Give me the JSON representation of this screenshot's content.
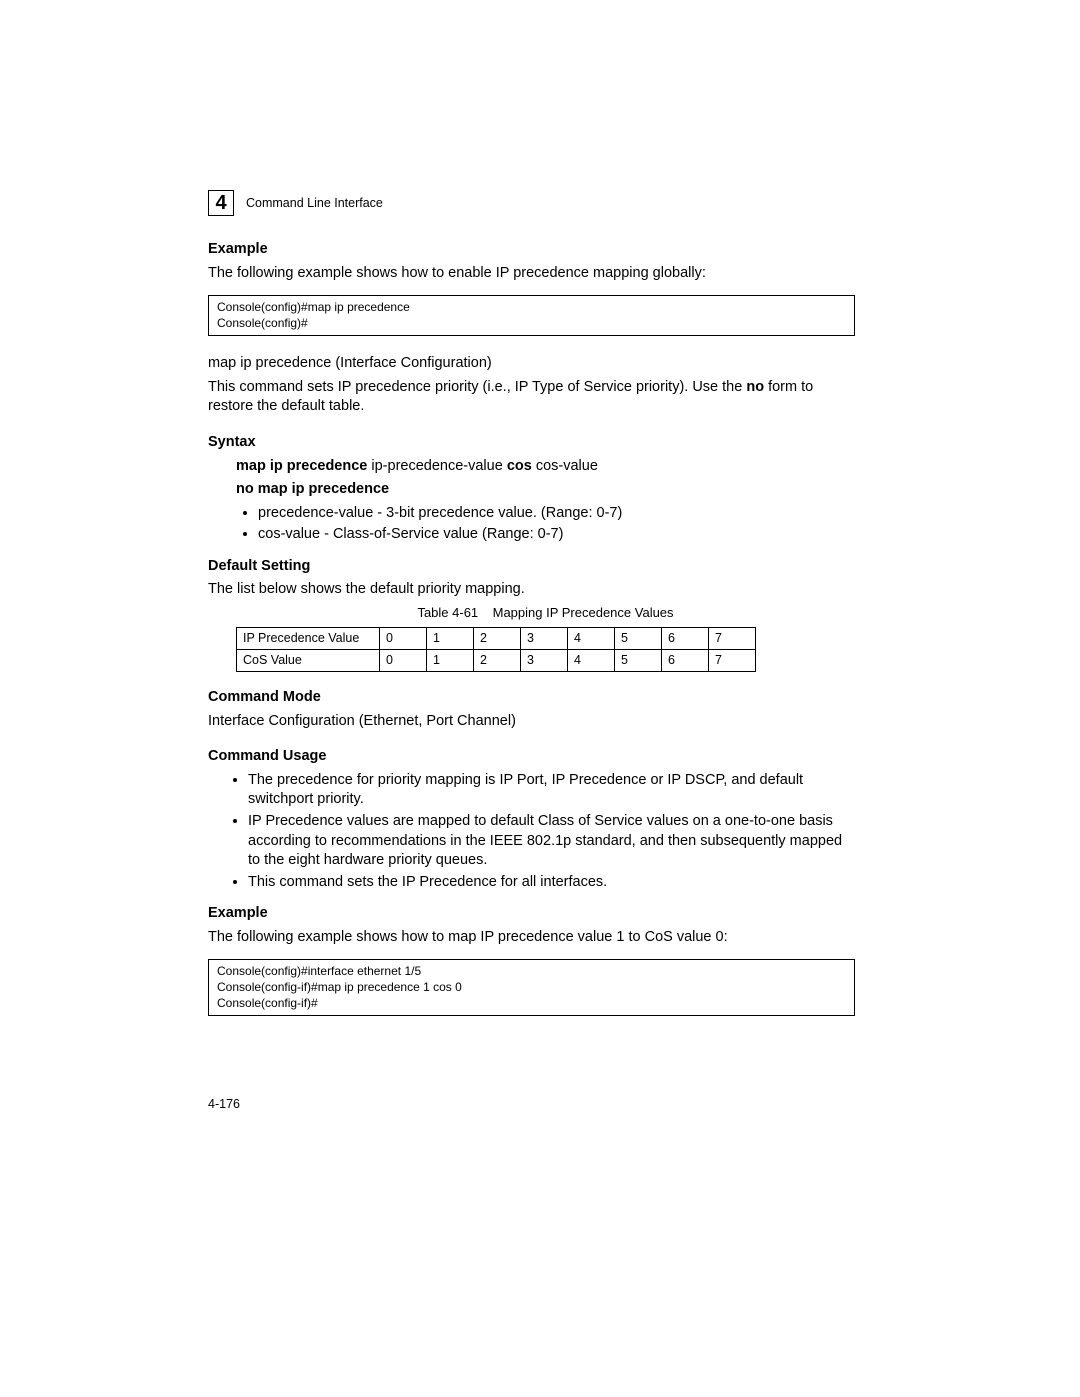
{
  "chapter_number": "4",
  "chapter_label": "Command Line Interface",
  "sec1": {
    "heading": "Example",
    "intro": "The following example shows how to enable IP precedence mapping globally:",
    "code": "Console(config)#map ip precedence\nConsole(config)#"
  },
  "cmd": {
    "title": "map ip precedence   (Interface Configuration)",
    "desc_a": "This command sets IP precedence priority (i.e., IP Type of Service priority). Use the ",
    "desc_b_bold": "no",
    "desc_c": " form to restore the default table."
  },
  "syntax": {
    "heading": "Syntax",
    "l1_b1": "map ip precedence",
    "l1_p1": " ip-precedence-value ",
    "l1_b2": "cos",
    "l1_p2": " cos-value",
    "l2_bold": "no map ip precedence",
    "b1": "precedence-value - 3-bit precedence value. (Range: 0-7)",
    "b2": "cos-value - Class-of-Service value (Range: 0-7)"
  },
  "default": {
    "heading": "Default Setting",
    "text": "The list below shows the default priority mapping."
  },
  "table": {
    "caption_num": "Table 4-61",
    "caption_txt": "Mapping IP Precedence Values",
    "row1_label": "IP Precedence Value",
    "row2_label": "CoS Value",
    "row1": [
      "0",
      "1",
      "2",
      "3",
      "4",
      "5",
      "6",
      "7"
    ],
    "row2": [
      "0",
      "1",
      "2",
      "3",
      "4",
      "5",
      "6",
      "7"
    ]
  },
  "mode": {
    "heading": "Command Mode",
    "text": "Interface Configuration (Ethernet, Port Channel)"
  },
  "usage": {
    "heading": "Command Usage",
    "b1": "The precedence for priority mapping is IP Port, IP Precedence or IP DSCP, and default switchport priority.",
    "b2": "IP Precedence values are mapped to default Class of Service values on a one-to-one basis according to recommendations in the IEEE 802.1p standard, and then subsequently mapped to the eight hardware priority queues.",
    "b3": "This command sets the IP Precedence for all interfaces."
  },
  "sec2": {
    "heading": "Example",
    "intro": "The following example shows how to map IP precedence value 1 to CoS value 0:",
    "code": "Console(config)#interface ethernet 1/5\nConsole(config-if)#map ip precedence 1 cos 0\nConsole(config-if)#"
  },
  "page_number": "4-176"
}
